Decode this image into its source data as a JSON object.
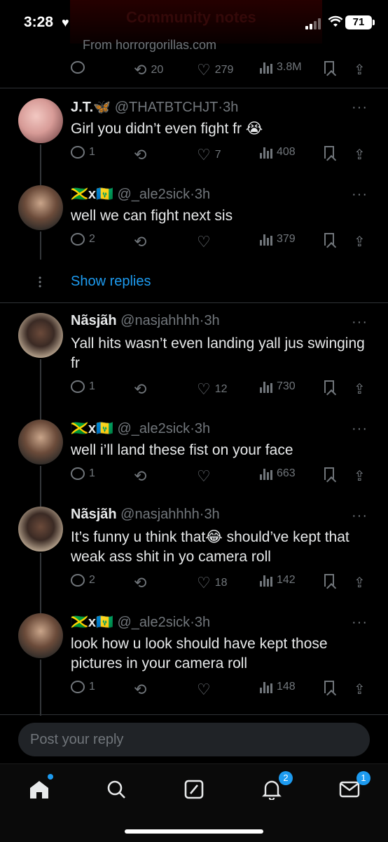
{
  "status_bar": {
    "time": "3:28",
    "battery": "71",
    "banner_text": "Community notes"
  },
  "top_tweet": {
    "url_text": "From horrorgorillas.com",
    "retweets": "20",
    "likes": "279",
    "views": "3.8M"
  },
  "tweets": [
    {
      "name": "J.T.🦋",
      "handle": "@THATBTCHJT",
      "time": "3h",
      "text": "Girl you didn’t even fight fr 😭",
      "replies": "1",
      "retweets": "",
      "likes": "7",
      "views": "408"
    },
    {
      "name": "🇯🇲x🇻🇨",
      "handle": "@_ale2sick",
      "time": "3h",
      "text": "well we can fight next sis",
      "replies": "2",
      "retweets": "",
      "likes": "",
      "views": "379"
    },
    {
      "name": "Nãsjãh",
      "handle": "@nasjahhhh",
      "time": "3h",
      "text": "Yall hits wasn’t even landing yall jus swinging fr",
      "replies": "1",
      "retweets": "",
      "likes": "12",
      "views": "730"
    },
    {
      "name": "🇯🇲x🇻🇨",
      "handle": "@_ale2sick",
      "time": "3h",
      "text": "well i’ll land these fist on your face",
      "replies": "1",
      "retweets": "",
      "likes": "",
      "views": "663"
    },
    {
      "name": "Nãsjãh",
      "handle": "@nasjahhhh",
      "time": "3h",
      "text": "It’s funny u think that😂 should’ve kept that weak ass shit in yo camera roll",
      "replies": "2",
      "retweets": "",
      "likes": "18",
      "views": "142"
    },
    {
      "name": "🇯🇲x🇻🇨",
      "handle": "@_ale2sick",
      "time": "3h",
      "text": "look how u look should have kept those pictures in your camera roll",
      "replies": "1",
      "retweets": "",
      "likes": "",
      "views": "148"
    }
  ],
  "show_replies": "Show replies",
  "reply_box": {
    "placeholder": "Post your reply"
  },
  "tabbar": {
    "notifications_badge": "2",
    "messages_badge": "1"
  },
  "colors": {
    "accent": "#1d9bf0",
    "muted": "#71767b",
    "text": "#e7e9ea",
    "background": "#000000"
  }
}
